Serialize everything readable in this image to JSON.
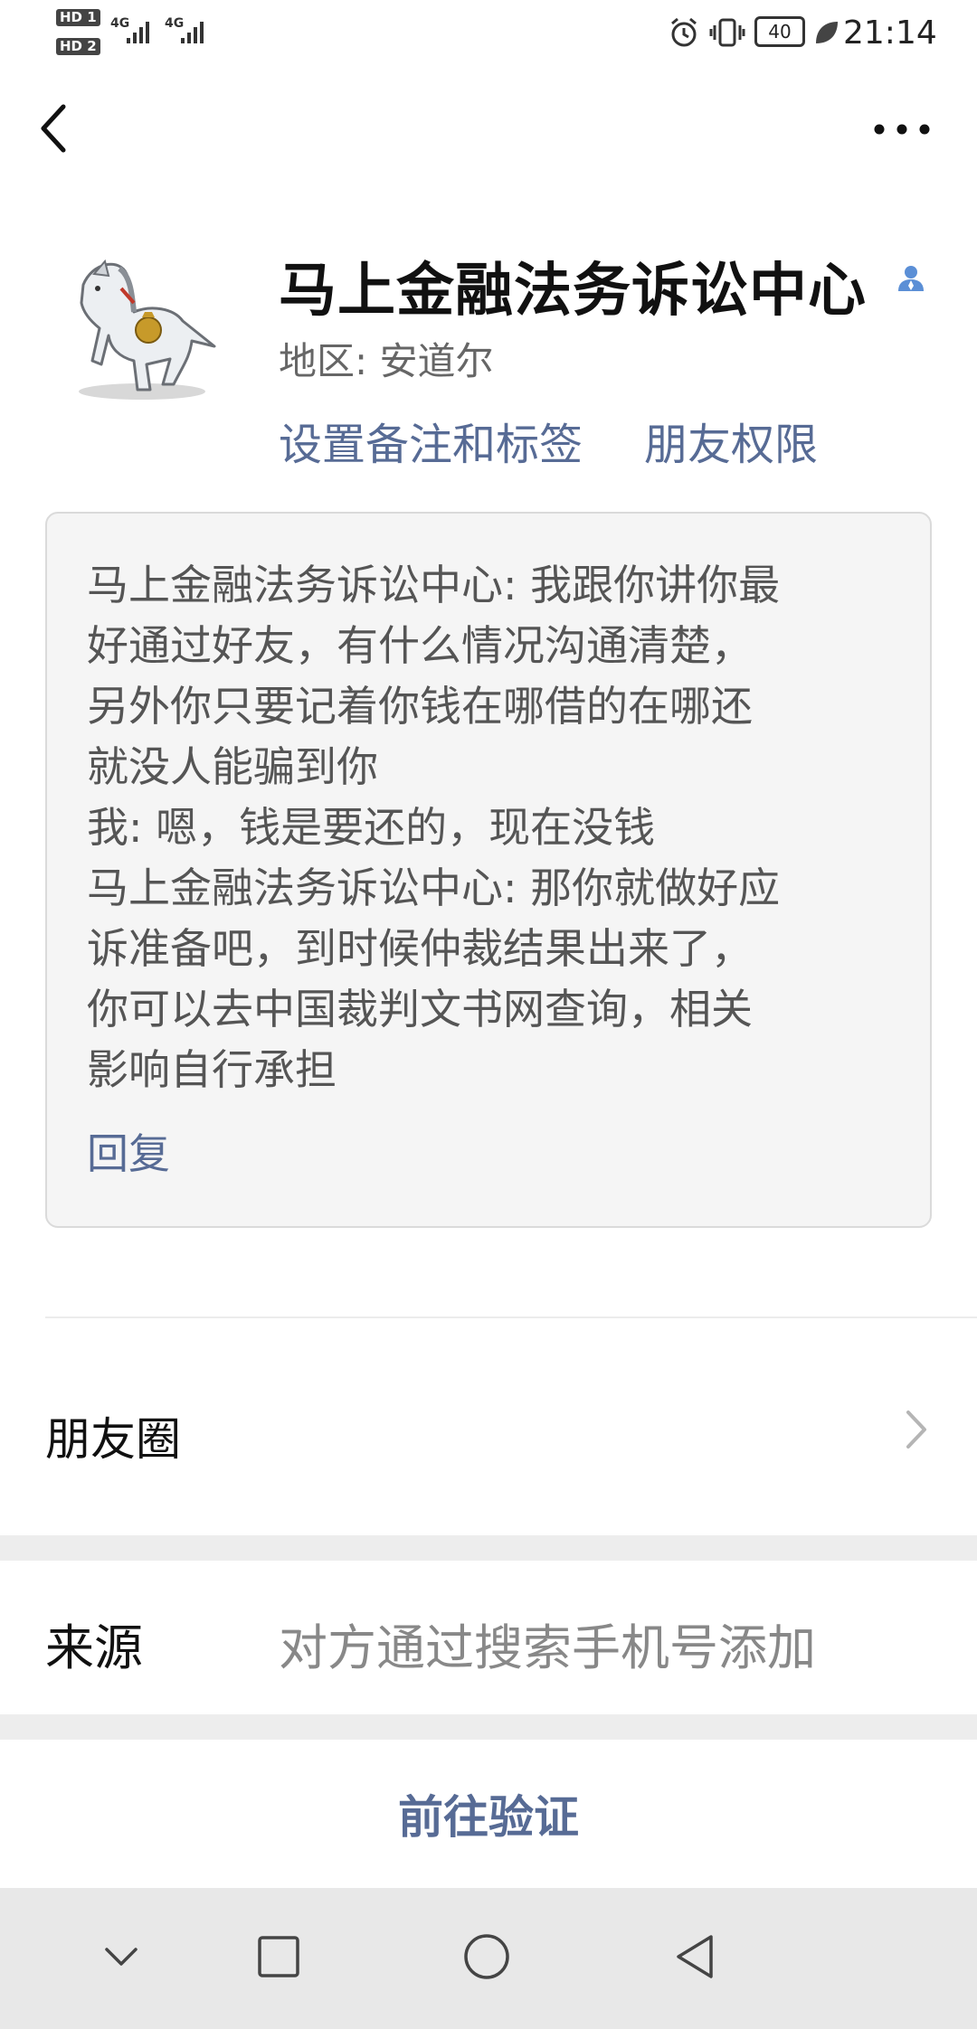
{
  "status_bar": {
    "sim1": "HD 1",
    "sim2": "HD 2",
    "net1": "4G",
    "net2": "4G",
    "battery": "40",
    "time": "21:14"
  },
  "nav": {
    "back_icon": "chevron-left-icon",
    "more_icon": "more-dots-icon"
  },
  "profile": {
    "name": "马上金融法务诉讼中心",
    "region": "地区:  安道尔",
    "set_remark_label": "设置备注和标签",
    "friend_permission_label": "朋友权限"
  },
  "message": {
    "lines": [
      "马上金融法务诉讼中心: 我跟你讲你最",
      "好通过好友，有什么情况沟通清楚，",
      "另外你只要记着你钱在哪借的在哪还",
      "就没人能骗到你",
      "我: 嗯，钱是要还的，现在没钱",
      "马上金融法务诉讼中心: 那你就做好应",
      "诉准备吧，到时候仲裁结果出来了，",
      "你可以去中国裁判文书网查询，相关",
      "影响自行承担"
    ],
    "reply_label": "回复"
  },
  "moments": {
    "label": "朋友圈"
  },
  "source": {
    "label": "来源",
    "value": "对方通过搜索手机号添加"
  },
  "verify": {
    "label": "前往验证"
  },
  "colors": {
    "link": "#576b95",
    "gap": "#ededed",
    "navbar": "#e8e8e8"
  }
}
